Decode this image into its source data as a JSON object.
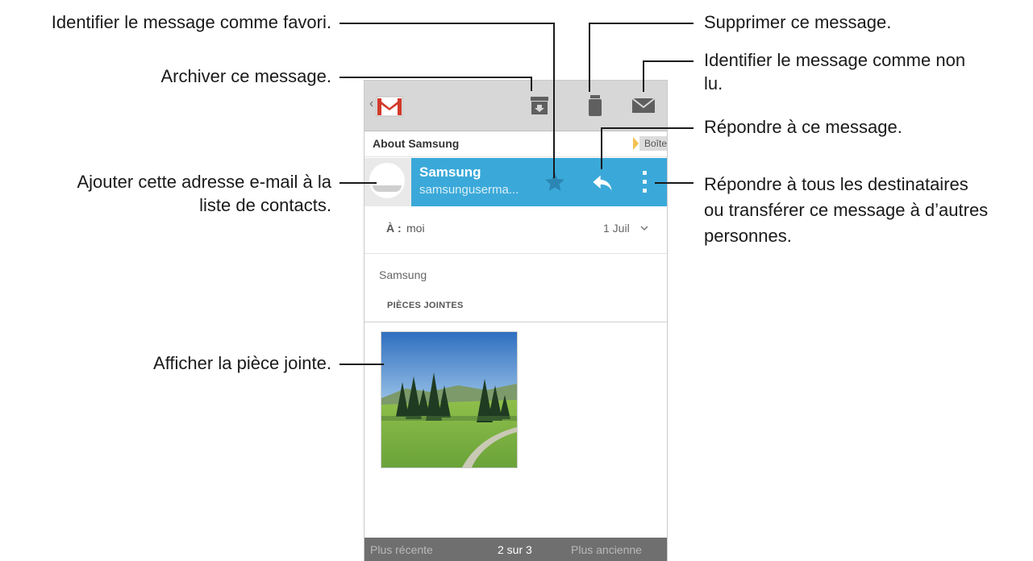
{
  "callouts": {
    "favorite": "Identifier le message comme favori.",
    "archive": "Archiver ce message.",
    "add_contact_1": "Ajouter cette adresse e-mail à la",
    "add_contact_2": "liste de contacts.",
    "view_attachment": "Afficher la pièce jointe.",
    "delete": "Supprimer ce message.",
    "mark_unread_1": "Identifier le message comme non",
    "mark_unread_2": "lu.",
    "reply": "Répondre à ce message.",
    "reply_all_1": "Répondre à tous les destinataires",
    "reply_all_2": "ou transférer ce message à d’autres",
    "reply_all_3": "personnes."
  },
  "app": {
    "back_glyph": "‹",
    "logo_icon": "gmail-logo-icon",
    "toolbar_icons": [
      "archive-icon",
      "trash-icon",
      "mark-unread-icon"
    ]
  },
  "email": {
    "subject": "About Samsung",
    "label": "Boîte de réception",
    "label_color": "#f2c14e",
    "sender_name": "Samsung",
    "sender_email": "samsunguserma...",
    "accent_color": "#3aa9d9",
    "to_label": "À :",
    "to_value": "moi",
    "date": "1 Juil",
    "body": "Samsung",
    "attachments_header": "PIÈCES JOINTES"
  },
  "footer": {
    "newer": "Plus récente",
    "count": "2 sur 3",
    "older": "Plus ancienne"
  }
}
